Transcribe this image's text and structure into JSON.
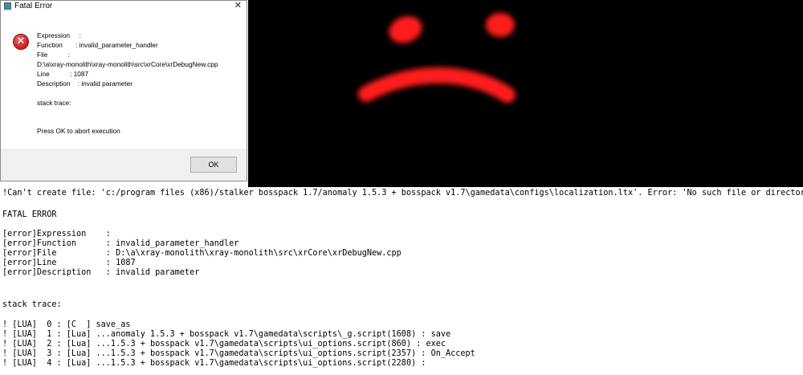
{
  "dialog": {
    "title": "Fatal Error",
    "close_glyph": "✕",
    "error_icon": "x-circle-icon",
    "lines": [
      "Expression     :",
      "Function       : invalid_parameter_handler",
      "File           :",
      "D:\\a\\xray-monolith\\xray-monolith\\src\\xrCore\\xrDebugNew.cpp",
      "Line           : 1087",
      "Description    : invalid parameter",
      "stack trace:",
      "Press OK to abort execution"
    ],
    "ok_label": "OK"
  },
  "game": {
    "description_colors": {
      "background": "#000000",
      "face": "#ff1a1a"
    }
  },
  "console": {
    "lines": [
      "!Can't create file: 'c:/program files (x86)/stalker bosspack 1.7/anomaly 1.5.3 + bosspack v1.7\\gamedata\\configs\\localization.ltx'. Error: 'No such file or directory'.",
      "",
      "FATAL ERROR",
      "",
      "[error]Expression    :",
      "[error]Function      : invalid_parameter_handler",
      "[error]File          : D:\\a\\xray-monolith\\xray-monolith\\src\\xrCore\\xrDebugNew.cpp",
      "[error]Line          : 1087",
      "[error]Description   : invalid parameter",
      "",
      "",
      "stack trace:",
      "",
      "! [LUA]  0 : [C  ] save_as",
      "! [LUA]  1 : [Lua] ...anomaly 1.5.3 + bosspack v1.7\\gamedata\\scripts\\_g.script(1608) : save",
      "! [LUA]  2 : [Lua] ...1.5.3 + bosspack v1.7\\gamedata\\scripts\\ui_options.script(860) : exec",
      "! [LUA]  3 : [Lua] ...1.5.3 + bosspack v1.7\\gamedata\\scripts\\ui_options.script(2357) : On_Accept",
      "! [LUA]  4 : [Lua] ...1.5.3 + bosspack v1.7\\gamedata\\scripts\\ui_options.script(2280) :"
    ]
  }
}
